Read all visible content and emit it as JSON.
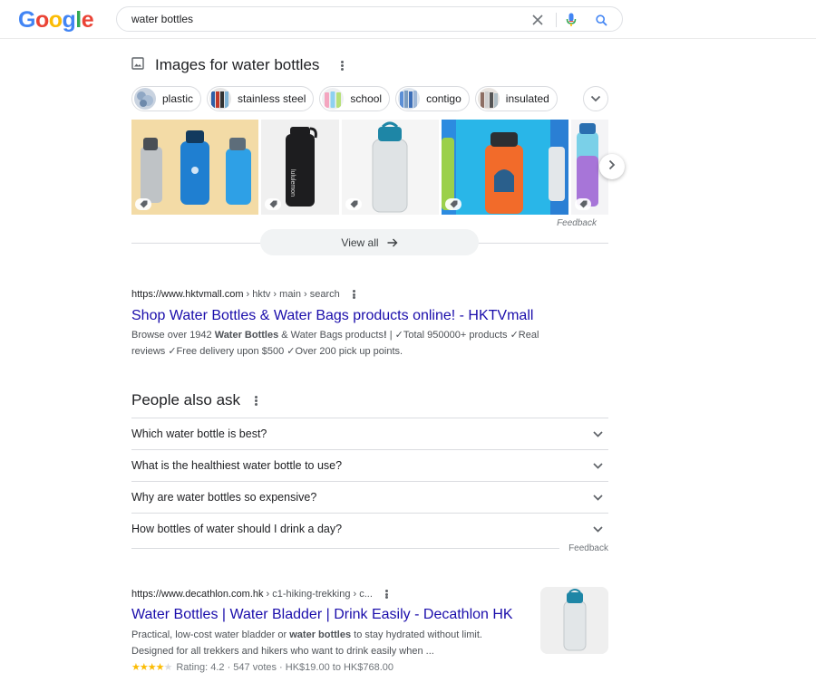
{
  "logo": {
    "letters": [
      "G",
      "o",
      "o",
      "g",
      "l",
      "e"
    ],
    "colors": [
      "#4285f4",
      "#ea4335",
      "#fbbc05",
      "#4285f4",
      "#34a853",
      "#ea4335"
    ]
  },
  "search": {
    "query": "water bottles",
    "clear_icon": "close-icon",
    "voice_icon": "mic-icon",
    "search_icon": "search-icon"
  },
  "images": {
    "heading": "Images for water bottles",
    "chips": [
      {
        "label": "plastic"
      },
      {
        "label": "stainless steel"
      },
      {
        "label": "school"
      },
      {
        "label": "contigo"
      },
      {
        "label": "insulated"
      }
    ],
    "tile_brand_text": "lululemon",
    "feedback": "Feedback",
    "view_all": "View all"
  },
  "result1": {
    "domain": "https://www.hktvmall.com",
    "path": "› hktv › main › search",
    "title": "Shop Water Bottles & Water Bags products online! - HKTVmall",
    "snippet_parts": [
      "Browse over 1942 ",
      "Water Bottles",
      " & Water Bags products",
      "!",
      " | ✓Total 950000+ products ✓Real reviews ✓Free delivery upon $500 ✓Over 200 pick up points."
    ]
  },
  "paa": {
    "heading": "People also ask",
    "questions": [
      "Which water bottle is best?",
      "What is the healthiest water bottle to use?",
      "Why are water bottles so expensive?",
      "How bottles of water should I drink a day?"
    ],
    "feedback": "Feedback"
  },
  "result2": {
    "domain": "https://www.decathlon.com.hk",
    "path": "› c1-hiking-trekking › c...",
    "title": "Water Bottles | Water Bladder | Drink Easily - Decathlon HK",
    "snippet_parts": [
      "Practical, low-cost water bladder or ",
      "water bottles",
      " to stay hydrated without limit. Designed for all trekkers and hikers who want to drink easily when ..."
    ],
    "rating": {
      "stars_filled": "★★★★",
      "stars_empty": "★",
      "text": "Rating: 4.2 · 547 votes · HK$19.00 to HK$768.00",
      "value": 4.2
    }
  }
}
